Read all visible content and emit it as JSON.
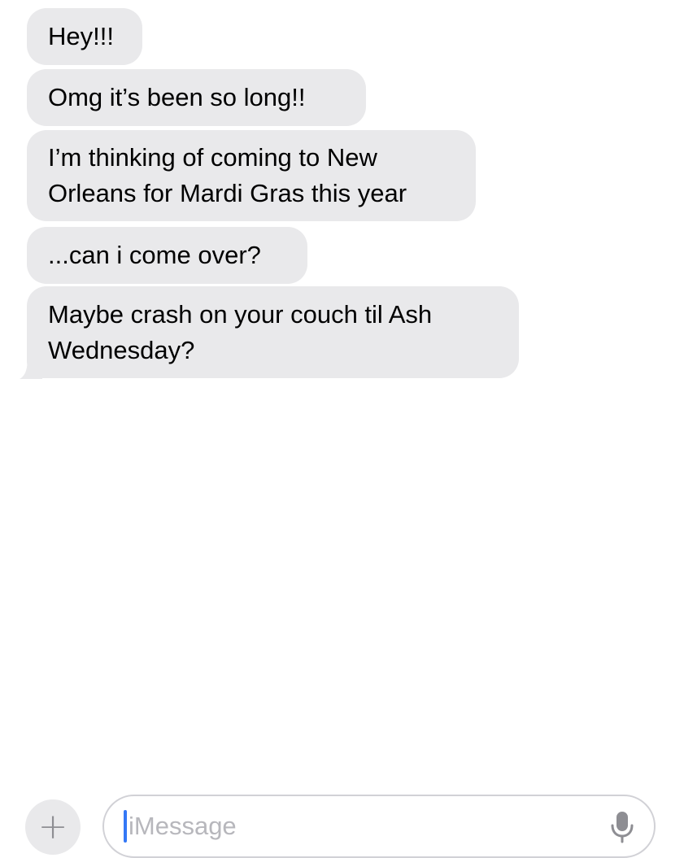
{
  "messages": [
    {
      "text": "Hey!!!"
    },
    {
      "text": "Omg it’s been so long!!"
    },
    {
      "text": "I’m thinking of coming to New\nOrleans for Mardi Gras this year"
    },
    {
      "text": "...can i come over?"
    },
    {
      "text": "Maybe crash on your couch til Ash\nWednesday?"
    }
  ],
  "composer": {
    "add_button_label": "+",
    "placeholder": "iMessage"
  },
  "icons": {
    "add": "plus-icon",
    "dictation": "microphone-icon"
  },
  "colors": {
    "incoming_bubble": "#e9e9eb",
    "caret": "#3478f6",
    "placeholder": "#b7b7bc"
  }
}
